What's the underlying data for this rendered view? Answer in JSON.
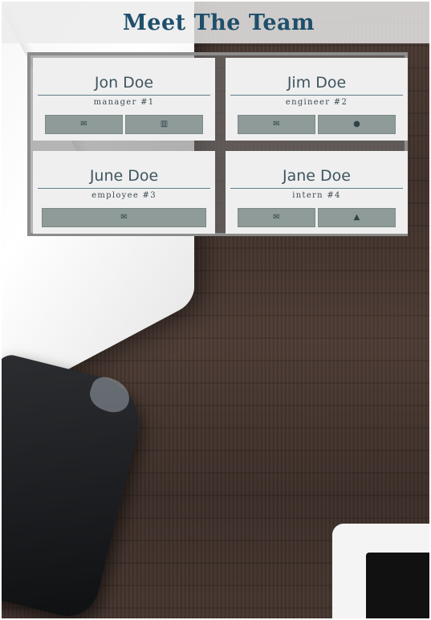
{
  "page": {
    "title": "Meet The Team"
  },
  "team": [
    {
      "name": "Jon Doe",
      "role": "manager #1",
      "buttons": [
        {
          "icon": "envelope-icon",
          "glyph": "✉"
        },
        {
          "icon": "building-icon",
          "glyph": "▥"
        }
      ]
    },
    {
      "name": "Jim Doe",
      "role": "engineer #2",
      "buttons": [
        {
          "icon": "envelope-icon",
          "glyph": "✉"
        },
        {
          "icon": "github-icon",
          "glyph": "●"
        }
      ]
    },
    {
      "name": "June Doe",
      "role": "employee #3",
      "buttons": [
        {
          "icon": "envelope-icon",
          "glyph": "✉"
        }
      ]
    },
    {
      "name": "Jane Doe",
      "role": "intern #4",
      "buttons": [
        {
          "icon": "envelope-icon",
          "glyph": "✉"
        },
        {
          "icon": "graduation-cap-icon",
          "glyph": "▲"
        }
      ]
    }
  ]
}
